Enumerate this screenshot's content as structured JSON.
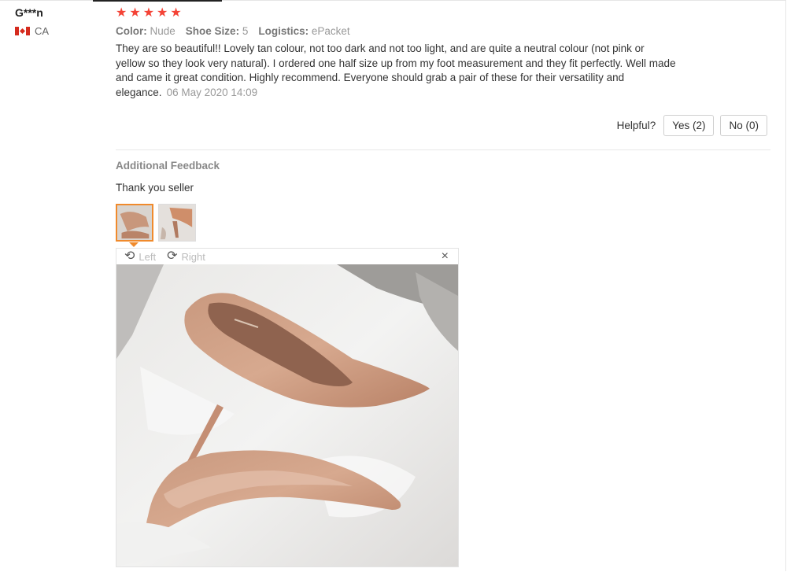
{
  "user": {
    "name": "G***n",
    "country": "CA",
    "flag_icon": "canada-flag-icon"
  },
  "rating": {
    "stars": 5,
    "max": 5,
    "color": "#f44336"
  },
  "meta": [
    {
      "key": "Color:",
      "value": "Nude"
    },
    {
      "key": "Shoe Size:",
      "value": "5"
    },
    {
      "key": "Logistics:",
      "value": "ePacket"
    }
  ],
  "review": {
    "text": "They are so beautiful!! Lovely tan colour, not too dark and not too light, and are quite a neutral colour (not pink or yellow so they look very natural). I ordered one half size up from my foot measurement and they fit perfectly. Well made and came it great condition. Highly recommend. Everyone should grab a pair of these for their versatility and elegance.",
    "date": "06 May 2020 14:09"
  },
  "helpful": {
    "label": "Helpful?",
    "yes": "Yes (2)",
    "no": "No (0)"
  },
  "additional": {
    "title": "Additional Feedback",
    "text": "Thank you seller"
  },
  "viewer": {
    "rotate_left": "Left",
    "rotate_right": "Right",
    "close_symbol": "×",
    "rotate_left_symbol": "⟲",
    "rotate_right_symbol": "⟳"
  },
  "accent_color": "#f08a2c"
}
